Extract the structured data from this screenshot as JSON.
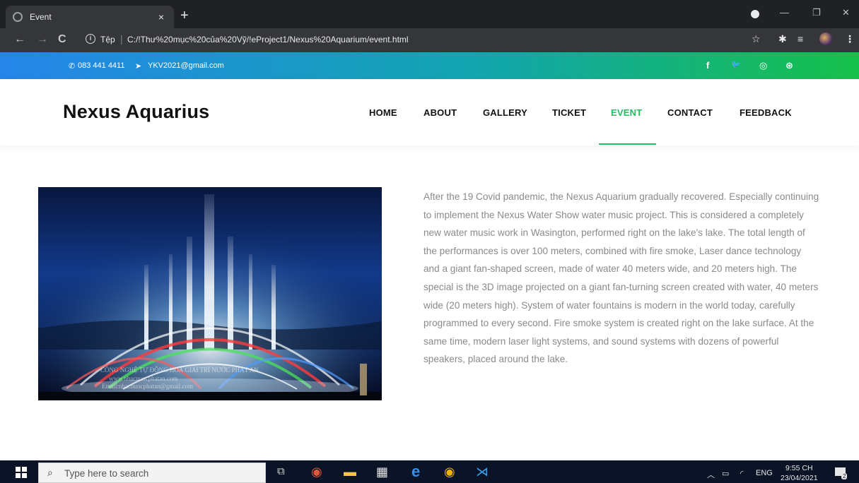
{
  "browser": {
    "tab_title": "Event",
    "tab_close": "×",
    "new_tab": "+",
    "scheme_label": "Tệp",
    "url": "C:/!Thư%20mục%20của%20Vỹ/!eProject1/Nexus%20Aquarium/event.html",
    "window_controls": {
      "minimize": "—",
      "restore": "❐",
      "close": "✕"
    }
  },
  "topbar": {
    "phone": "083 441 4411",
    "email": "YKV2021@gmail.com",
    "social": [
      "f",
      "🐦",
      "◎",
      "⊛"
    ]
  },
  "header": {
    "logo": "Nexus Aquarius",
    "menu": [
      {
        "label": "HOME"
      },
      {
        "label": "ABOUT"
      },
      {
        "label": "GALLERY"
      },
      {
        "label": "TICKET"
      },
      {
        "label": "EVENT"
      },
      {
        "label": "CONTACT"
      },
      {
        "label": "FEEDBACK"
      }
    ],
    "active_item": "EVENT"
  },
  "content": {
    "image_watermark": [
      "CÔNG NGHỆ TỰ ĐỘNG HOÁ GIẢI TRÍ NƯỚC PHÁT AN",
      "www.nhacnuocphatan.com",
      "Email:nhacnuocphatan@gmail.com"
    ],
    "article": "After the 19 Covid pandemic, the Nexus Aquarium gradually recovered. Especially continuing to implement the Nexus Water Show water music project. This is considered a completely new water music work in Wasington, performed right on the lake's lake. The total length of the performances is over 100 meters, combined with fire smoke, Laser dance technology and a giant fan-shaped screen, made of water 40 meters wide, and 20 meters high. The special is the 3D image projected on a giant fan-turning screen created with water, 40 meters wide (20 meters high). System of water fountains is modern in the world today, carefully programmed to every second. Fire smoke system is created right on the lake surface. At the same time, modern laser light systems, and sound systems with dozens of powerful speakers, placed around the lake."
  },
  "taskbar": {
    "search_placeholder": "Type here to search",
    "language": "ENG",
    "time": "9:55 CH",
    "date": "23/04/2021",
    "notifications": "2"
  },
  "colors": {
    "accent": "#1fbf62",
    "topbar_start": "#2585e9",
    "topbar_end": "#17c04a",
    "text_body": "#8a8a8a"
  }
}
